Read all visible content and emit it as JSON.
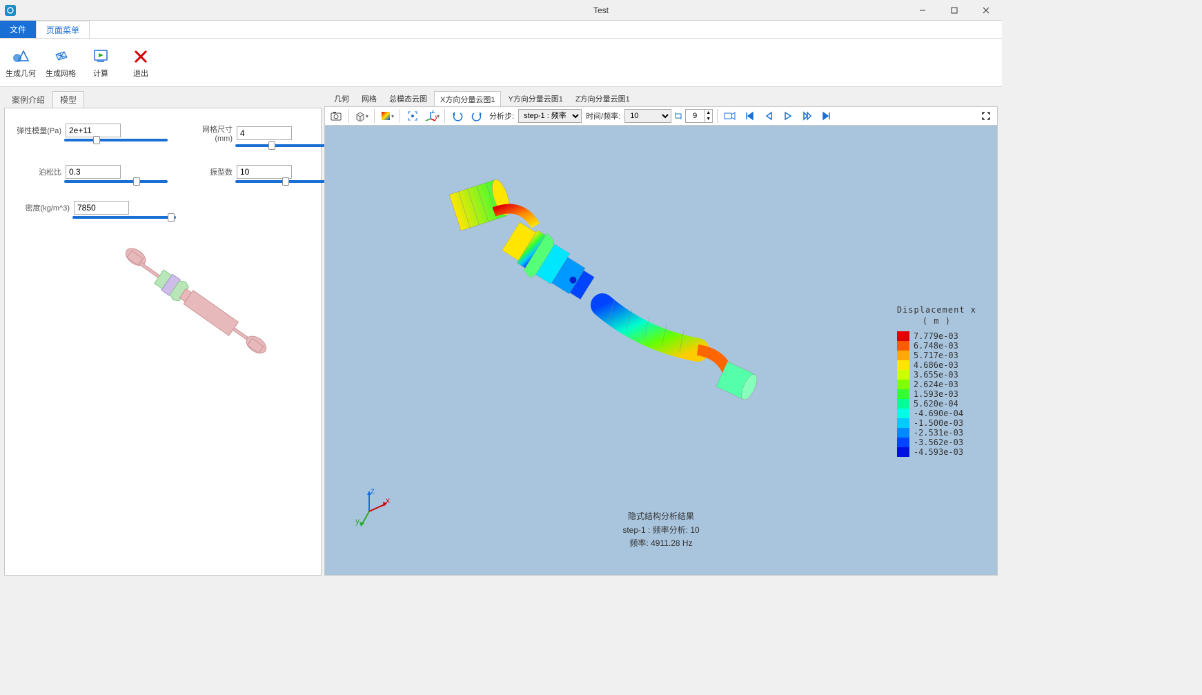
{
  "window": {
    "title": "Test"
  },
  "menu": {
    "file": "文件",
    "page": "页面菜单"
  },
  "ribbon": {
    "gen_geom": "生成几何",
    "gen_mesh": "生成网格",
    "calc": "计算",
    "exit": "退出"
  },
  "left_tabs": {
    "intro": "案例介绍",
    "model": "模型"
  },
  "params": {
    "elastic_label": "弹性模量(Pa)",
    "elastic_value": "2e+11",
    "mesh_label": "网格尺寸(mm)",
    "mesh_value": "4",
    "poisson_label": "泊松比",
    "poisson_value": "0.3",
    "modes_label": "振型数",
    "modes_value": "10",
    "density_label": "密度(kg/m^3)",
    "density_value": "7850"
  },
  "view_tabs": {
    "geom": "几何",
    "mesh": "网格",
    "total": "总模态云图",
    "x": "X方向分量云图1",
    "y": "Y方向分量云图1",
    "z": "Z方向分量云图1"
  },
  "toolbar": {
    "step_label": "分析步:",
    "step_value": "step-1 : 频率",
    "time_label": "时间/频率:",
    "time_value": "10",
    "spinner_value": "9"
  },
  "legend": {
    "title1": "Displacement x",
    "title2": "( m )",
    "values": [
      "7.779e-03",
      "6.748e-03",
      "5.717e-03",
      "4.686e-03",
      "3.655e-03",
      "2.624e-03",
      "1.593e-03",
      "5.620e-04",
      "-4.690e-04",
      "-1.500e-03",
      "-2.531e-03",
      "-3.562e-03",
      "-4.593e-03"
    ],
    "colors": [
      "#e40000",
      "#ff5a00",
      "#ffaa00",
      "#ffe600",
      "#ccff00",
      "#80ff00",
      "#33ff33",
      "#00ff99",
      "#00ffe6",
      "#00ccff",
      "#0088ff",
      "#0044ff",
      "#0011dd"
    ]
  },
  "result": {
    "line1": "隐式结构分析结果",
    "line2": "step-1 : 频率分析: 10",
    "line3": "频率:  4911.28 Hz"
  }
}
